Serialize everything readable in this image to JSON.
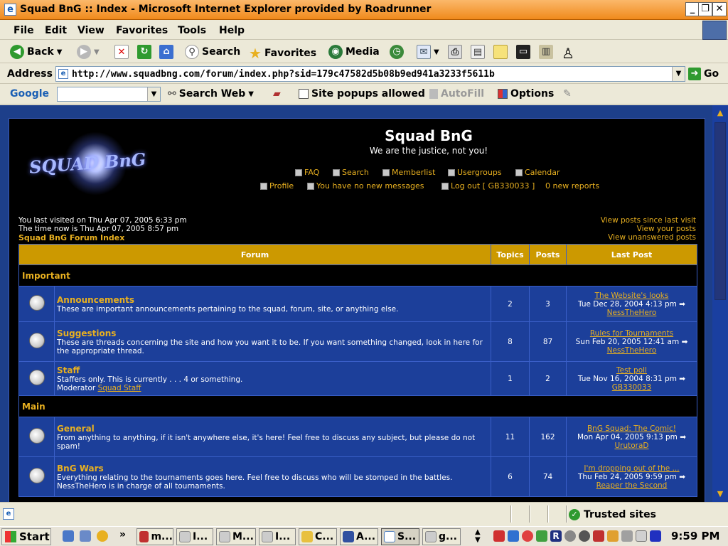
{
  "window": {
    "title": "Squad BnG :: Index - Microsoft Internet Explorer provided by Roadrunner"
  },
  "menu": [
    "File",
    "Edit",
    "View",
    "Favorites",
    "Tools",
    "Help"
  ],
  "toolbar": {
    "back": "Back",
    "search": "Search",
    "favorites": "Favorites",
    "media": "Media"
  },
  "address": {
    "label": "Address",
    "url": "http://www.squadbng.com/forum/index.php?sid=179c47582d5b08b9ed941a3233f5611b",
    "go": "Go"
  },
  "googlebar": {
    "brand": "Google",
    "search_web": "Search Web",
    "popups": "Site popups allowed",
    "autofill": "AutoFill",
    "options": "Options"
  },
  "site": {
    "name": "Squad BnG",
    "tagline": "We are the justice, not you!",
    "logo_text": "SQUAD BnG",
    "nav": {
      "faq": "FAQ",
      "search": "Search",
      "memberlist": "Memberlist",
      "usergroups": "Usergroups",
      "calendar": "Calendar",
      "profile": "Profile",
      "messages": "You have no new messages",
      "logout": "Log out [ GB330033 ]",
      "reports": "0 new reports"
    },
    "last_visit": "You last visited on Thu Apr 07, 2005 6:33 pm",
    "time_now": "The time now is Thu Apr 07, 2005 8:57 pm",
    "index_link": "Squad BnG Forum Index",
    "right_links": [
      "View posts since last visit",
      "View your posts",
      "View unanswered posts"
    ]
  },
  "table": {
    "headers": {
      "forum": "Forum",
      "topics": "Topics",
      "posts": "Posts",
      "last_post": "Last Post"
    },
    "categories": {
      "important": "Important",
      "main": "Main"
    },
    "rows": [
      {
        "title": "Announcements",
        "desc": "These are important announcements pertaining to the squad, forum, site, or anything else.",
        "moderator_label": "",
        "moderator": "",
        "topics": "2",
        "posts": "3",
        "last_title": "The Website's looks",
        "last_date": "Tue Dec 28, 2004 4:13 pm",
        "last_user": "NessTheHero"
      },
      {
        "title": "Suggestions",
        "desc": "These are threads concerning the site and how you want it to be. If you want something changed, look in here for the appropriate thread.",
        "moderator_label": "",
        "moderator": "",
        "topics": "8",
        "posts": "87",
        "last_title": "Rules for Tournaments",
        "last_date": "Sun Feb 20, 2005 12:41 am",
        "last_user": "NessTheHero"
      },
      {
        "title": "Staff",
        "desc": "Staffers only. This is currently . . . 4 or something.",
        "moderator_label": "Moderator",
        "moderator": "Squad Staff",
        "topics": "1",
        "posts": "2",
        "last_title": "Test poll",
        "last_date": "Tue Nov 16, 2004 8:31 pm",
        "last_user": "GB330033"
      },
      {
        "title": "General",
        "desc": "From anything to anything, if it isn't anywhere else, it's here! Feel free to discuss any subject, but please do not spam!",
        "moderator_label": "",
        "moderator": "",
        "topics": "11",
        "posts": "162",
        "last_title": "BnG Squad: The Comic!",
        "last_date": "Mon Apr 04, 2005 9:13 pm",
        "last_user": "UrutoraD"
      },
      {
        "title": "BnG Wars",
        "desc": "Everything relating to the tournaments goes here. Feel free to discuss who will be stomped in the battles. NessTheHero is in charge of all tournaments.",
        "moderator_label": "",
        "moderator": "",
        "topics": "6",
        "posts": "74",
        "last_title": "I'm dropping out of the ...",
        "last_date": "Thu Feb 24, 2005 9:59 pm",
        "last_user": "Reaper the Second"
      }
    ]
  },
  "status": {
    "zone": "Trusted sites"
  },
  "taskbar": {
    "start": "Start",
    "chevron": "»",
    "tasks": [
      "m...",
      "I...",
      "M...",
      "I...",
      "C...",
      "A...",
      "S...",
      "g..."
    ],
    "clock": "9:59 PM"
  },
  "colors": {
    "accent": "#e8b020",
    "header_bg": "#cc9900",
    "row_bg": "#1c3f9a",
    "page_bg": "#1d3f8a"
  }
}
